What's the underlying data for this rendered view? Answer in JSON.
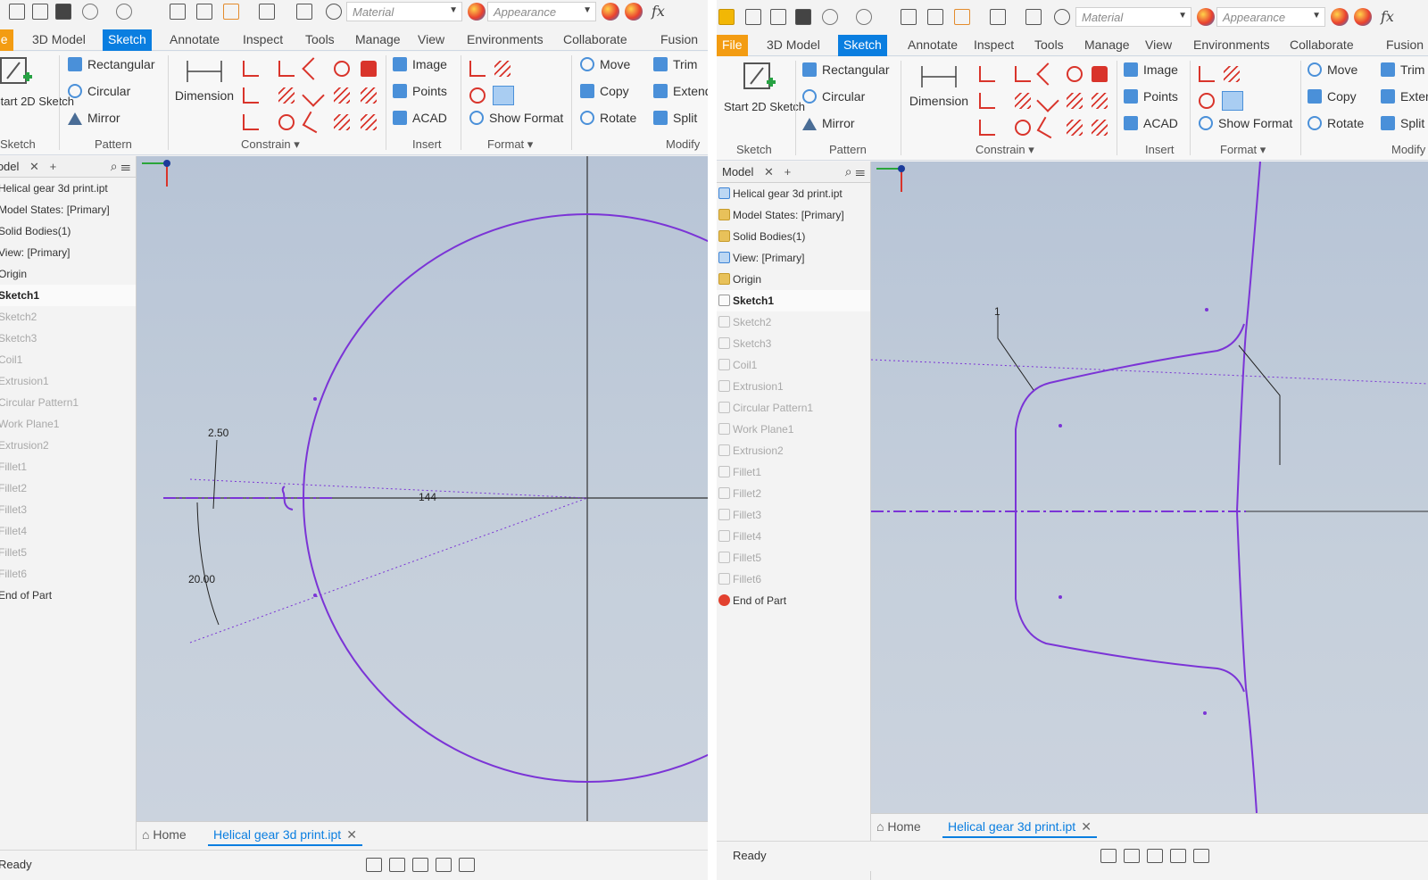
{
  "toolbar": {
    "material_placeholder": "Material",
    "appearance_placeholder": "Appearance",
    "fx": "fx"
  },
  "menu_tabs": [
    "File",
    "3D Model",
    "Sketch",
    "Annotate",
    "Inspect",
    "Tools",
    "Manage",
    "View",
    "Environments",
    "Collaborate",
    "Fusion"
  ],
  "active_tab": "Sketch",
  "ribbon": {
    "start_sketch": "Start 2D Sketch",
    "sketch_group": "Sketch",
    "rectangular": "Rectangular",
    "circular": "Circular",
    "mirror": "Mirror",
    "pattern_group": "Pattern",
    "dimension": "Dimension",
    "constrain_group": "Constrain",
    "image": "Image",
    "points": "Points",
    "acad": "ACAD",
    "insert_group": "Insert",
    "show_format": "Show Format",
    "format_group": "Format",
    "move": "Move",
    "copy": "Copy",
    "rotate": "Rotate",
    "modify_group": "Modify",
    "trim": "Trim",
    "extend": "Extend",
    "split": "Split"
  },
  "browser": {
    "tab": "Model",
    "items": [
      {
        "label": "Helical gear 3d print.ipt",
        "state": "normal",
        "icon": "part-icon"
      },
      {
        "label": "Model States: [Primary]",
        "state": "normal",
        "icon": "folder-icon"
      },
      {
        "label": "Solid Bodies(1)",
        "state": "normal",
        "icon": "folder-icon"
      },
      {
        "label": "View: [Primary]",
        "state": "normal",
        "icon": "view-icon"
      },
      {
        "label": "Origin",
        "state": "normal",
        "icon": "folder-icon"
      },
      {
        "label": "Sketch1",
        "state": "selected",
        "icon": "sketch-icon"
      },
      {
        "label": "Sketch2",
        "state": "dim",
        "icon": "sketch-icon"
      },
      {
        "label": "Sketch3",
        "state": "dim",
        "icon": "sketch-icon"
      },
      {
        "label": "Coil1",
        "state": "dim",
        "icon": "coil-icon"
      },
      {
        "label": "Extrusion1",
        "state": "dim",
        "icon": "extrude-icon"
      },
      {
        "label": "Circular Pattern1",
        "state": "dim",
        "icon": "pattern-icon"
      },
      {
        "label": "Work Plane1",
        "state": "dim",
        "icon": "plane-icon"
      },
      {
        "label": "Extrusion2",
        "state": "dim",
        "icon": "extrude-icon"
      },
      {
        "label": "Fillet1",
        "state": "dim",
        "icon": "fillet-icon"
      },
      {
        "label": "Fillet2",
        "state": "dim",
        "icon": "fillet-icon"
      },
      {
        "label": "Fillet3",
        "state": "dim",
        "icon": "fillet-icon"
      },
      {
        "label": "Fillet4",
        "state": "dim",
        "icon": "fillet-icon"
      },
      {
        "label": "Fillet5",
        "state": "dim",
        "icon": "fillet-icon"
      },
      {
        "label": "Fillet6",
        "state": "dim",
        "icon": "fillet-icon"
      },
      {
        "label": "End of Part",
        "state": "normal",
        "icon": "end-of-part-icon"
      }
    ]
  },
  "canvas_left": {
    "dim_top": "2.50",
    "dim_angle": "20.00",
    "dim_radius": "144"
  },
  "canvas_right": {
    "dim_label": "1"
  },
  "doc": {
    "home": "Home",
    "file_tab": "Helical gear 3d print.ipt"
  },
  "status": {
    "text": "Ready"
  },
  "colors": {
    "sketch_curve": "#7b34d6",
    "active_tab": "#0a7ee0",
    "file_tab": "#f39c12"
  }
}
